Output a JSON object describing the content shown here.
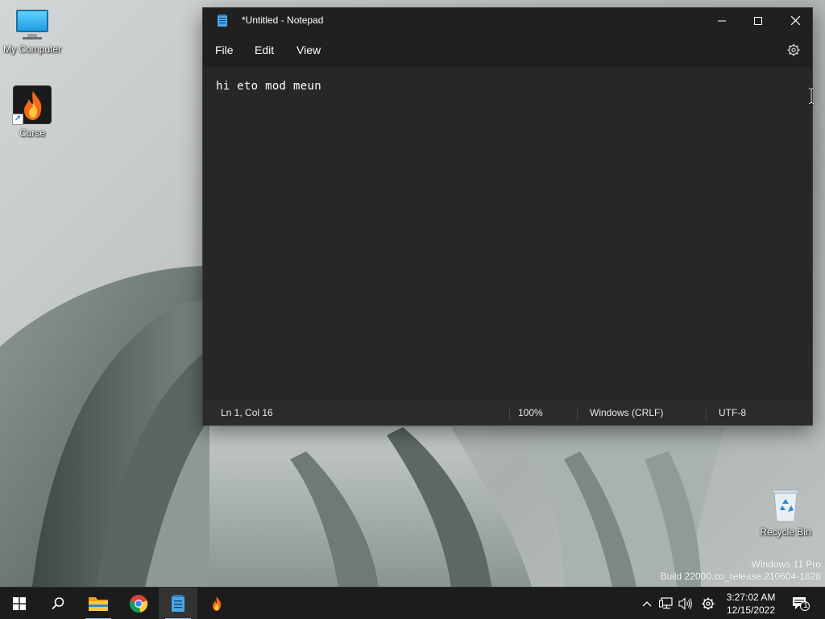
{
  "desktop": {
    "icons": [
      {
        "label": "My Computer"
      },
      {
        "label": "Curse"
      },
      {
        "label": "Recycle Bin"
      }
    ],
    "watermark": {
      "line1": "Windows 11 Pro",
      "line2": "Build 22000.co_release.210604-1628"
    }
  },
  "notepad": {
    "title": "*Untitled - Notepad",
    "menu": {
      "file": "File",
      "edit": "Edit",
      "view": "View"
    },
    "content": "hi eto mod meun",
    "status": {
      "position": "Ln 1, Col 16",
      "zoom": "100%",
      "line_ending": "Windows (CRLF)",
      "encoding": "UTF-8"
    },
    "controls": {
      "minimize": "—",
      "maximize": "☐",
      "close": "✕"
    }
  },
  "taskbar": {
    "apps": [
      {
        "name": "start",
        "icon": "windows-logo-icon"
      },
      {
        "name": "search",
        "icon": "search-icon"
      },
      {
        "name": "file-explorer",
        "icon": "folder-icon"
      },
      {
        "name": "chrome",
        "icon": "chrome-icon"
      },
      {
        "name": "notepad",
        "icon": "notepad-icon",
        "active": true
      },
      {
        "name": "curse",
        "icon": "flame-icon"
      }
    ],
    "tray": {
      "chevron": "^",
      "notification_count": "1"
    },
    "clock": {
      "time": "3:27:02 AM",
      "date": "12/15/2022"
    }
  },
  "colors": {
    "window_bg": "#272727",
    "titlebar_bg": "#202020",
    "taskbar_bg": "#1c1c1c",
    "accent": "#7fb7ea"
  }
}
